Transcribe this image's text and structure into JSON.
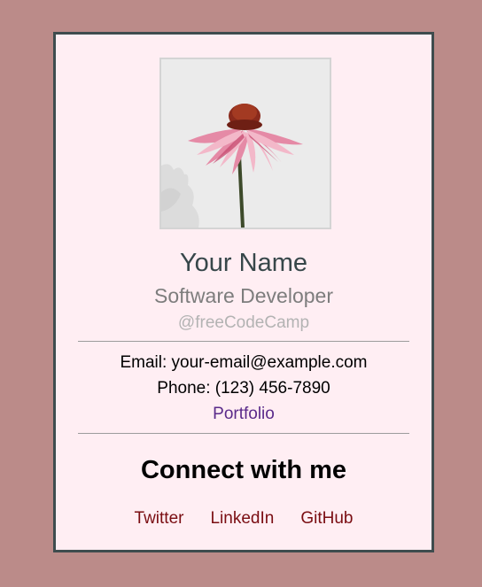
{
  "profile": {
    "name": "Your Name",
    "title": "Software Developer",
    "handle": "@freeCodeCamp"
  },
  "contact": {
    "email": "Email: your-email@example.com",
    "phone": "Phone: (123) 456-7890",
    "portfolio_label": "Portfolio"
  },
  "social": {
    "heading": "Connect with me",
    "links": [
      "Twitter",
      "LinkedIn",
      "GitHub"
    ]
  },
  "colors": {
    "page_background": "#bb8b89",
    "card_background": "#ffeef3",
    "card_border": "#3e4c4e",
    "link_portfolio": "#5a2a8a",
    "link_social": "#7a0d12"
  },
  "photo": {
    "icon": "coneflower-photo"
  }
}
